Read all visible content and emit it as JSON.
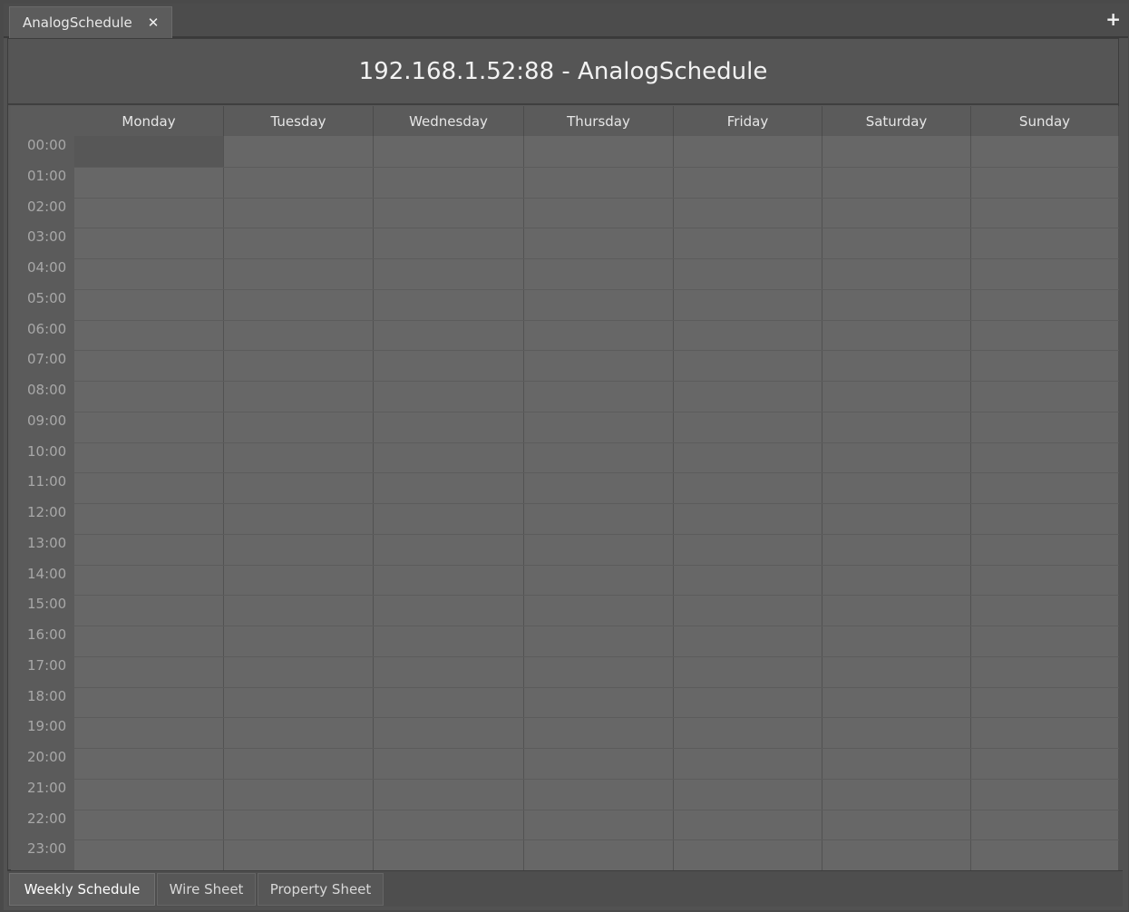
{
  "tab": {
    "label": "AnalogSchedule",
    "close_glyph": "✕"
  },
  "add_glyph": "+",
  "header": {
    "title": "192.168.1.52:88 - AnalogSchedule"
  },
  "days": [
    "Monday",
    "Tuesday",
    "Wednesday",
    "Thursday",
    "Friday",
    "Saturday",
    "Sunday"
  ],
  "hours": [
    "00:00",
    "01:00",
    "02:00",
    "03:00",
    "04:00",
    "05:00",
    "06:00",
    "07:00",
    "08:00",
    "09:00",
    "10:00",
    "11:00",
    "12:00",
    "13:00",
    "14:00",
    "15:00",
    "16:00",
    "17:00",
    "18:00",
    "19:00",
    "20:00",
    "21:00",
    "22:00",
    "23:00"
  ],
  "selection": {
    "day": "Monday",
    "hour": "00:00"
  },
  "view_tabs": [
    {
      "label": "Weekly Schedule",
      "active": true
    },
    {
      "label": "Wire Sheet",
      "active": false
    },
    {
      "label": "Property Sheet",
      "active": false
    }
  ]
}
